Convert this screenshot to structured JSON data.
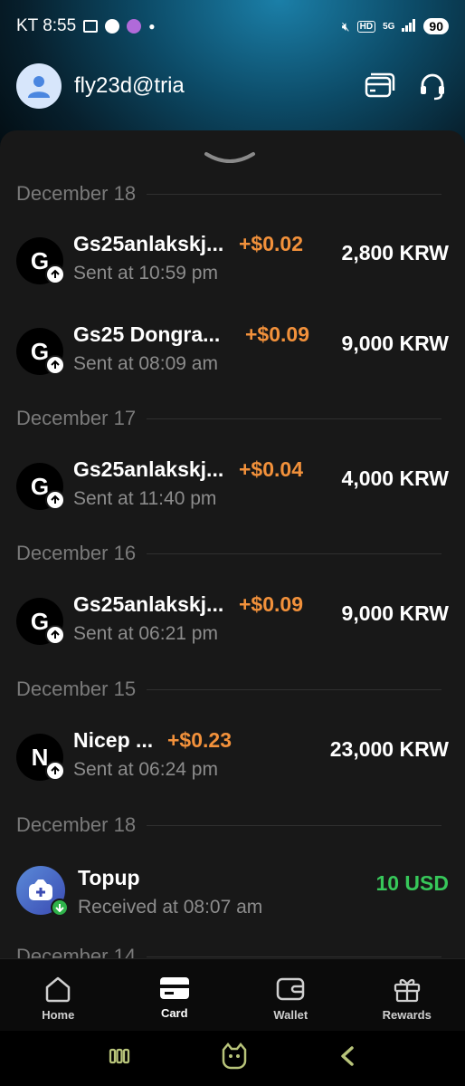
{
  "status_bar": {
    "carrier_time": "KT 8:55",
    "battery": "90"
  },
  "header": {
    "username": "fly23d@tria"
  },
  "sections": [
    {
      "date": "December 18",
      "transactions": [
        {
          "initial": "G",
          "title": "Gs25anlakskj...",
          "reward": "+$0.02",
          "subtitle": "Sent at 10:59 pm",
          "amount": "2,800 KRW"
        },
        {
          "initial": "G",
          "title": "Gs25 Dongra...",
          "reward": "+$0.09",
          "subtitle": "Sent at 08:09 am",
          "amount": "9,000 KRW"
        }
      ]
    },
    {
      "date": "December 17",
      "transactions": [
        {
          "initial": "G",
          "title": "Gs25anlakskj...",
          "reward": "+$0.04",
          "subtitle": "Sent at 11:40 pm",
          "amount": "4,000 KRW"
        }
      ]
    },
    {
      "date": "December 16",
      "transactions": [
        {
          "initial": "G",
          "title": "Gs25anlakskj...",
          "reward": "+$0.09",
          "subtitle": "Sent at 06:21 pm",
          "amount": "9,000 KRW"
        }
      ]
    },
    {
      "date": "December 15",
      "transactions": [
        {
          "initial": "N",
          "title": "Nicep ...",
          "reward": "+$0.23",
          "subtitle": "Sent at 06:24 pm",
          "amount": "23,000 KRW"
        }
      ]
    },
    {
      "date": "December 18",
      "transactions": [
        {
          "title": "Topup",
          "subtitle": "Received at 08:07 am",
          "amount": "10 USD"
        }
      ]
    },
    {
      "date": "December 14"
    }
  ],
  "bottom_nav": [
    {
      "label": "Home",
      "icon": "home-icon"
    },
    {
      "label": "Card",
      "icon": "card-icon",
      "active": true
    },
    {
      "label": "Wallet",
      "icon": "wallet-icon"
    },
    {
      "label": "Rewards",
      "icon": "gift-icon"
    }
  ],
  "colors": {
    "reward": "#f2913b",
    "received": "#37c75a",
    "sheet": "#181818"
  }
}
